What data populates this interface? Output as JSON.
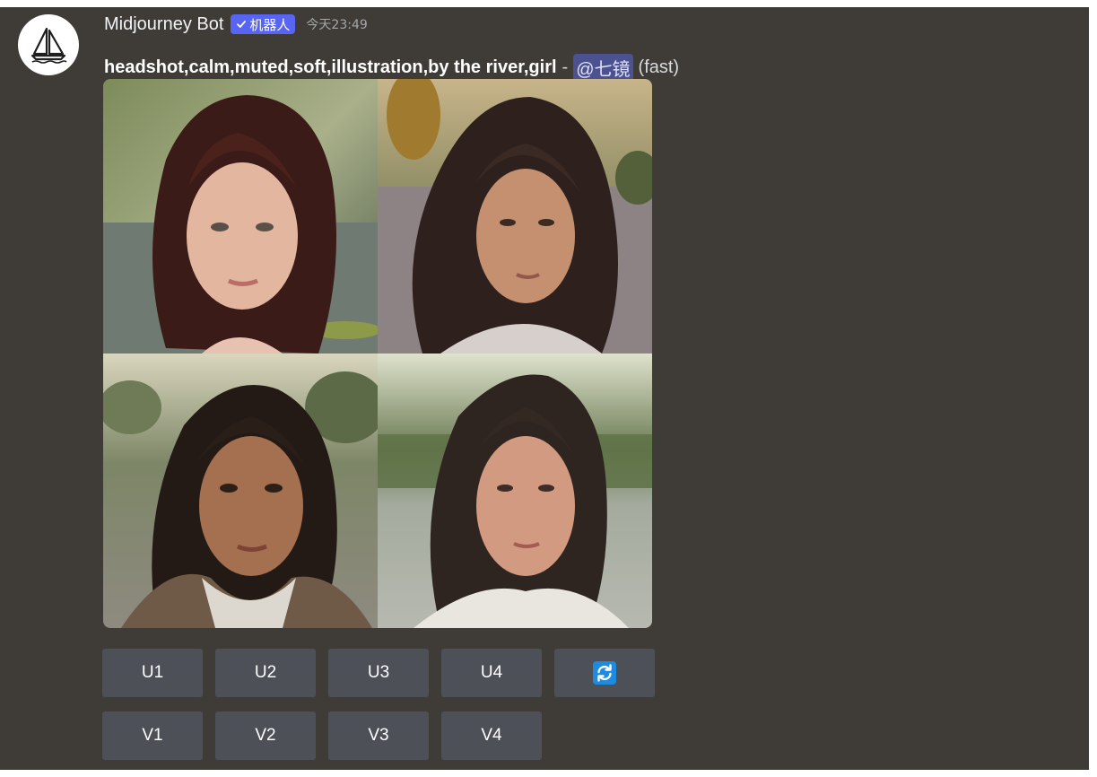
{
  "message": {
    "author": "Midjourney Bot",
    "bot_tag": "机器人",
    "timestamp": "今天23:49",
    "prompt": "headshot,calm,muted,soft,illustration,by the river,girl",
    "separator": "-",
    "mention": "@七镜",
    "mode": "(fast)"
  },
  "images": [
    {
      "name": "image-1"
    },
    {
      "name": "image-2"
    },
    {
      "name": "image-3"
    },
    {
      "name": "image-4"
    }
  ],
  "buttons": {
    "row1": [
      "U1",
      "U2",
      "U3",
      "U4"
    ],
    "reroll_icon": "refresh-icon",
    "row2": [
      "V1",
      "V2",
      "V3",
      "V4"
    ]
  },
  "colors": {
    "background": "#3f3c38",
    "button": "#4e5058",
    "bot_tag": "#5865f2",
    "mention_bg": "#4c5290",
    "reroll_icon": "#1d8ce0"
  }
}
